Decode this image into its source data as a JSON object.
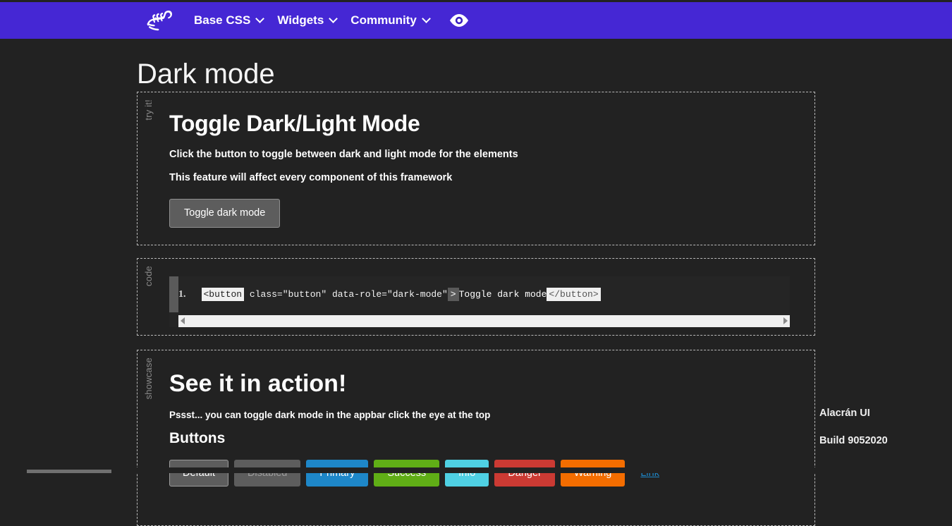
{
  "appbar": {
    "logo_icon": "scorpion-logo",
    "items": [
      {
        "label": "Base CSS",
        "caret": true
      },
      {
        "label": "Widgets",
        "caret": true
      },
      {
        "label": "Community",
        "caret": true
      }
    ],
    "eye_icon": "eye-icon",
    "background": "#4527d4"
  },
  "page": {
    "title": "Dark mode",
    "background": "#222222"
  },
  "try_it_card": {
    "side_label": "try it!",
    "heading": "Toggle Dark/Light Mode",
    "paragraph1": "Click the button to toggle between dark and light mode for the elements",
    "paragraph2": "This feature will affect every component of this framework",
    "button_label": "Toggle dark mode"
  },
  "code_card": {
    "side_label": "code",
    "line_number": "1.",
    "tokens": {
      "tag_open": "<button",
      "attrs": "class=\"button\" data-role=\"dark-mode\"",
      "gt": ">",
      "text": "Toggle dark mode",
      "tag_close": "</button>"
    }
  },
  "showcase_card": {
    "side_label": "showcase",
    "heading": "See it in action!",
    "paragraph": "Pssst... you can toggle dark mode in the appbar click the eye at the top",
    "subheading": "Buttons",
    "buttons": [
      {
        "label": "Default",
        "color": "#5d5d5d"
      },
      {
        "label": "Disabled",
        "color": "#5d5d5d"
      },
      {
        "label": "Primary",
        "color": "#1e87c8"
      },
      {
        "label": "Success",
        "color": "#60ae16"
      },
      {
        "label": "Info",
        "color": "#4fd0e3"
      },
      {
        "label": "Danger",
        "color": "#cb3a33"
      },
      {
        "label": "Warning",
        "color": "#f46d00"
      }
    ],
    "link_label": "Link"
  },
  "footer": {
    "name": "Alacrán UI",
    "build": "Build 9052020"
  }
}
